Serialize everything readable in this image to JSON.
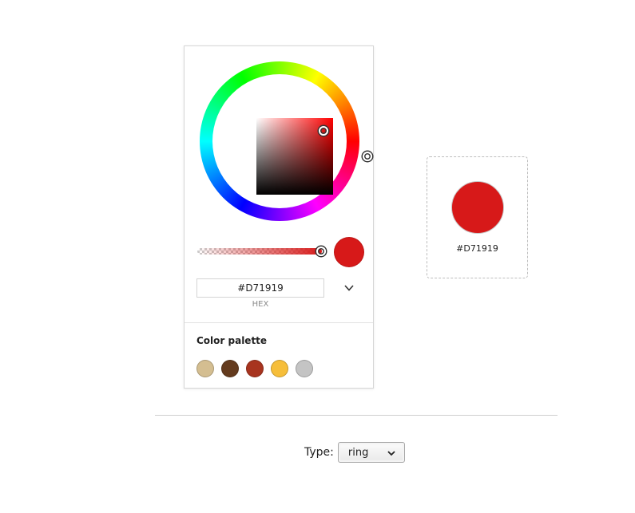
{
  "picker": {
    "current_hex": "#D71919",
    "current_color": "#D71919",
    "alpha_percent": 100,
    "hex_label": "HEX",
    "mode_toggle_icon": "chevron-down-icon",
    "palette": {
      "title": "Color palette",
      "swatches": [
        {
          "color": "#D4BE91"
        },
        {
          "color": "#643B1E"
        },
        {
          "color": "#A8341F"
        },
        {
          "color": "#F6BE3A"
        },
        {
          "color": "#C4C4C4"
        }
      ]
    }
  },
  "result": {
    "color": "#D71919",
    "label": "#D71919"
  },
  "type_selector": {
    "label": "Type:",
    "selected": "ring",
    "icon": "chevron-down-icon"
  }
}
